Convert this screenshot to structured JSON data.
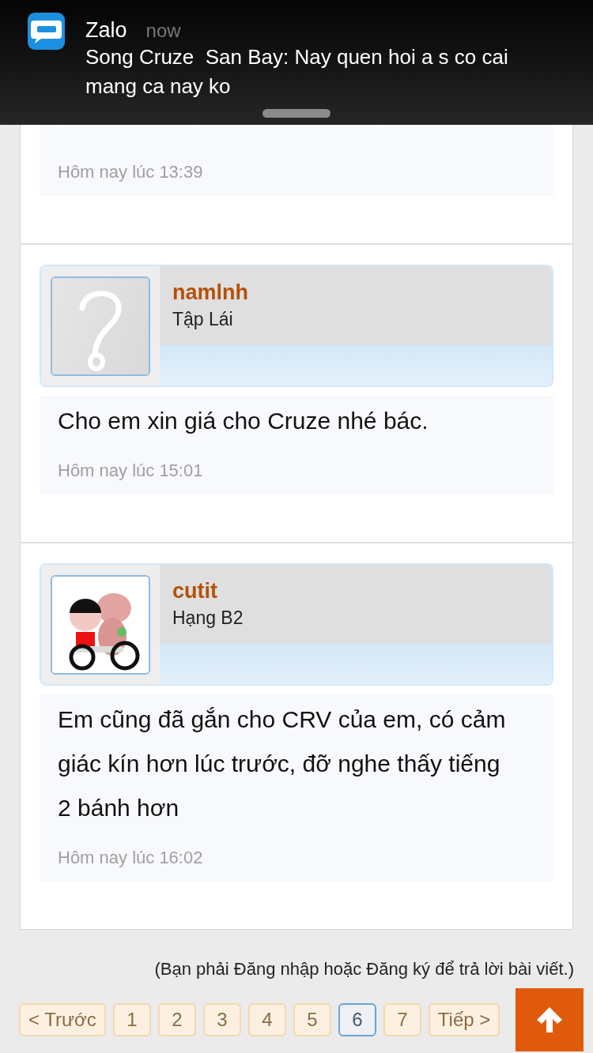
{
  "notification": {
    "app": "Zalo",
    "time": "now",
    "message": "Song Cruze  San Bay: Nay quen hoi a s co cai mang ca nay ko"
  },
  "posts": [
    {
      "timestamp": "Hôm nay lúc 13:39"
    },
    {
      "username": "namlnh",
      "rank": "Tập Lái",
      "avatar": {
        "kind": "placeholder"
      },
      "message": "Cho em xin giá cho Cruze nhé bác.",
      "timestamp": "Hôm nay lúc 15:01"
    },
    {
      "username": "cutit",
      "rank": "Hạng B2",
      "message": "Em cũng đã gắn cho CRV của em, có cảm giác kín hơn lúc trước, đỡ nghe thấy tiếng 2 bánh hơn",
      "timestamp": "Hôm nay lúc 16:02"
    }
  ],
  "reply_notice": "(Bạn phải Đăng nhập hoặc Đăng ký để trả lời bài viết.)",
  "pagination": {
    "prev": "< Trước",
    "next": "Tiếp >",
    "pages": [
      {
        "label": "1",
        "selected": false
      },
      {
        "label": "2",
        "selected": false
      },
      {
        "label": "3",
        "selected": false
      },
      {
        "label": "4",
        "selected": false
      },
      {
        "label": "5",
        "selected": false
      },
      {
        "label": "6",
        "selected": true
      },
      {
        "label": "7",
        "selected": false
      }
    ]
  }
}
